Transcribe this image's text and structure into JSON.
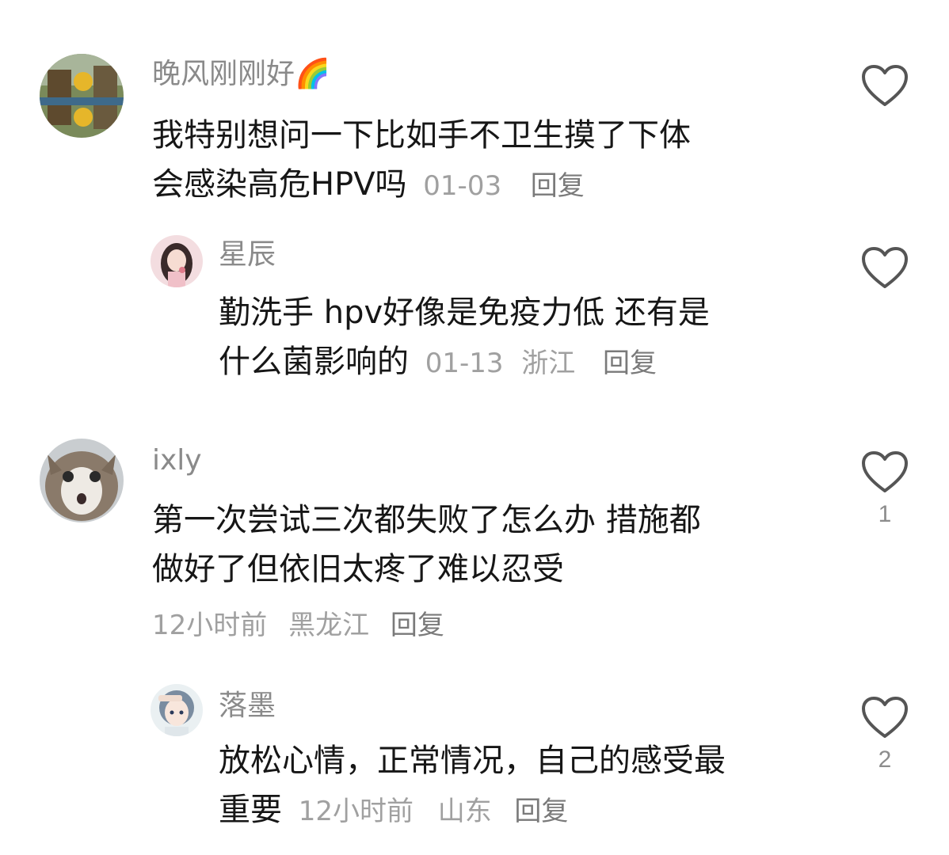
{
  "comments": [
    {
      "username": "晚风刚刚好",
      "emoji": "🌈",
      "avatar": "landscape-avatar",
      "text_lines": [
        "我特别想问一下比如手不卫生摸了下体",
        "会感染高危HPV吗"
      ],
      "time": "01-03",
      "location": "",
      "reply_label": "回复",
      "likes": ""
    },
    {
      "username": "星辰",
      "avatar": "girl-with-flower-avatar",
      "text_lines": [
        "勤洗手 hpv好像是免疫力低 还有是",
        "什么菌影响的"
      ],
      "time": "01-13",
      "location": "浙江",
      "reply_label": "回复",
      "likes": ""
    },
    {
      "username": "ixly",
      "avatar": "cat-avatar",
      "text_lines": [
        "第一次尝试三次都失败了怎么办 措施都",
        "做好了但依旧太疼了难以忍受"
      ],
      "time": "12小时前",
      "location": "黑龙江",
      "reply_label": "回复",
      "likes": "1"
    },
    {
      "username": "落墨",
      "avatar": "anime-girl-avatar",
      "text_lines": [
        "放松心情，正常情况，自己的感受最",
        "重要"
      ],
      "time": "12小时前",
      "location": "山东",
      "reply_label": "回复",
      "likes": "2"
    }
  ],
  "colors": {
    "username": "#8a8a8a",
    "text": "#161616",
    "meta": "#a0a0a0",
    "heart_outline": "#555555"
  }
}
